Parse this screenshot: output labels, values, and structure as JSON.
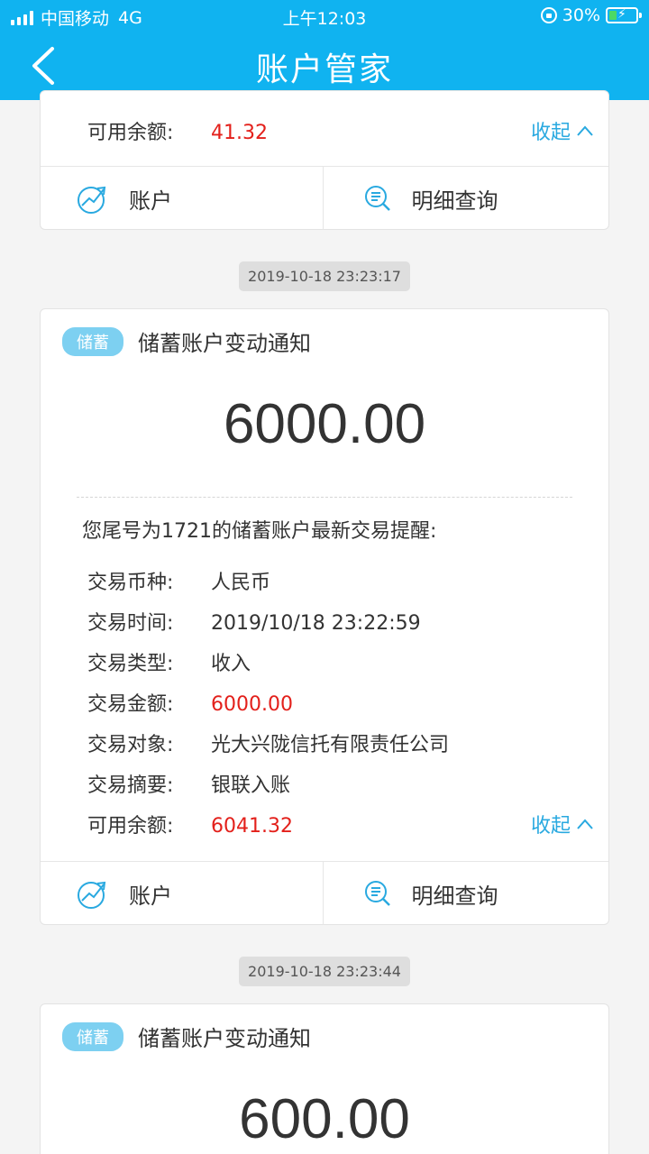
{
  "status_bar": {
    "carrier": "中国移动",
    "network": "4G",
    "time": "上午12:03",
    "battery": "30%",
    "battery_level": 0.3
  },
  "header": {
    "title": "账户管家"
  },
  "card_top": {
    "balance_label": "可用余额:",
    "balance_value": "41.32",
    "collapse_label": "收起",
    "account_button": "账户",
    "detail_button": "明细查询"
  },
  "msg1": {
    "timestamp": "2019-10-18 23:23:17",
    "tag": "储蓄",
    "title": "储蓄账户变动通知",
    "amount": "6000.00",
    "intro": "您尾号为1721的储蓄账户最新交易提醒:",
    "rows": [
      {
        "key": "交易币种:",
        "value": "人民币"
      },
      {
        "key": "交易时间:",
        "value": "2019/10/18 23:22:59"
      },
      {
        "key": "交易类型:",
        "value": "收入"
      },
      {
        "key": "交易金额:",
        "value": "6000.00"
      },
      {
        "key": "交易对象:",
        "value": "光大兴陇信托有限责任公司"
      },
      {
        "key": "交易摘要:",
        "value": "银联入账"
      },
      {
        "key": "可用余额:",
        "value": "6041.32"
      }
    ],
    "collapse_label": "收起",
    "account_button": "账户",
    "detail_button": "明细查询"
  },
  "msg2": {
    "timestamp": "2019-10-18 23:23:44",
    "tag": "储蓄",
    "title": "储蓄账户变动通知",
    "amount": "600.00"
  },
  "colors": {
    "brand": "#10b3f0",
    "link": "#29a9e0",
    "highlight": "#e3201b",
    "tag": "#7dd0f1"
  },
  "icons": {
    "account": "growth-chart-icon",
    "detail": "search-list-icon",
    "back": "chevron-left-icon"
  }
}
